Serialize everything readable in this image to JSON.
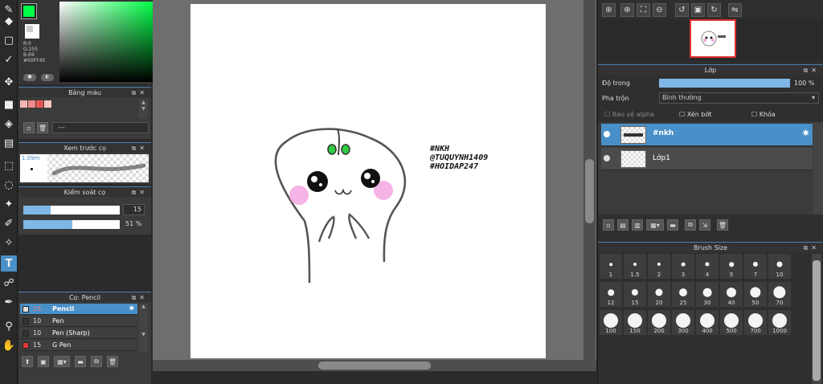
{
  "color_panel": {
    "main_color": "#00FF45",
    "r_label": "R:0",
    "g_label": "G:255",
    "b_label": "B:69",
    "hex_label": "#00FF45"
  },
  "palette_panel": {
    "title": "Bảng màu",
    "swatches": [
      "#f5b5b5",
      "#f08a8a",
      "#e85555",
      "#f7c8c8"
    ],
    "placeholder": "---"
  },
  "brush_preview_panel": {
    "title": "Xem trước cọ",
    "size_label": "1.09m"
  },
  "brush_control_panel": {
    "title": "Kiểm soát cọ",
    "size_value": "15",
    "size_fill": 0.28,
    "opacity_value": "51 %",
    "opacity_fill": 0.51
  },
  "brush_list_panel": {
    "title": "Cọ: Pencil",
    "items": [
      {
        "size": "15",
        "name": "Pencil",
        "color": "#e0e0e0",
        "selected": true
      },
      {
        "size": "10",
        "name": "Pen",
        "color": "#333333",
        "selected": false
      },
      {
        "size": "10",
        "name": "Pen (Sharp)",
        "color": "#333333",
        "selected": false
      },
      {
        "size": "15",
        "name": "G Pen",
        "color": "#e53935",
        "selected": false
      }
    ]
  },
  "canvas": {
    "text_lines": [
      "#NKH",
      "@TUQUYNH1409",
      "#HOIDAP247"
    ]
  },
  "layer_panel": {
    "title": "Lớp",
    "opacity_label": "Độ trong",
    "opacity_value": "100 %",
    "opacity_fill": 1.0,
    "blend_label": "Pha trộn",
    "blend_value": "Bình thường",
    "protect_alpha": "Bảo vệ alpha",
    "clipping": "Xén bớt",
    "lock": "Khóa",
    "layers": [
      {
        "name": "#nkh",
        "selected": true
      },
      {
        "name": "Lớp1",
        "selected": false
      }
    ]
  },
  "brush_size_panel": {
    "title": "Brush Size",
    "sizes": [
      "1",
      "1.5",
      "2",
      "3",
      "4",
      "5",
      "7",
      "10",
      "12",
      "15",
      "20",
      "25",
      "30",
      "40",
      "50",
      "70",
      "100",
      "150",
      "200",
      "300",
      "400",
      "500",
      "700",
      "1000"
    ]
  },
  "colors": {
    "accent": "#4a90c8",
    "panel_bg": "#3b3b3b",
    "workspace_bg": "#6e6e6e"
  }
}
